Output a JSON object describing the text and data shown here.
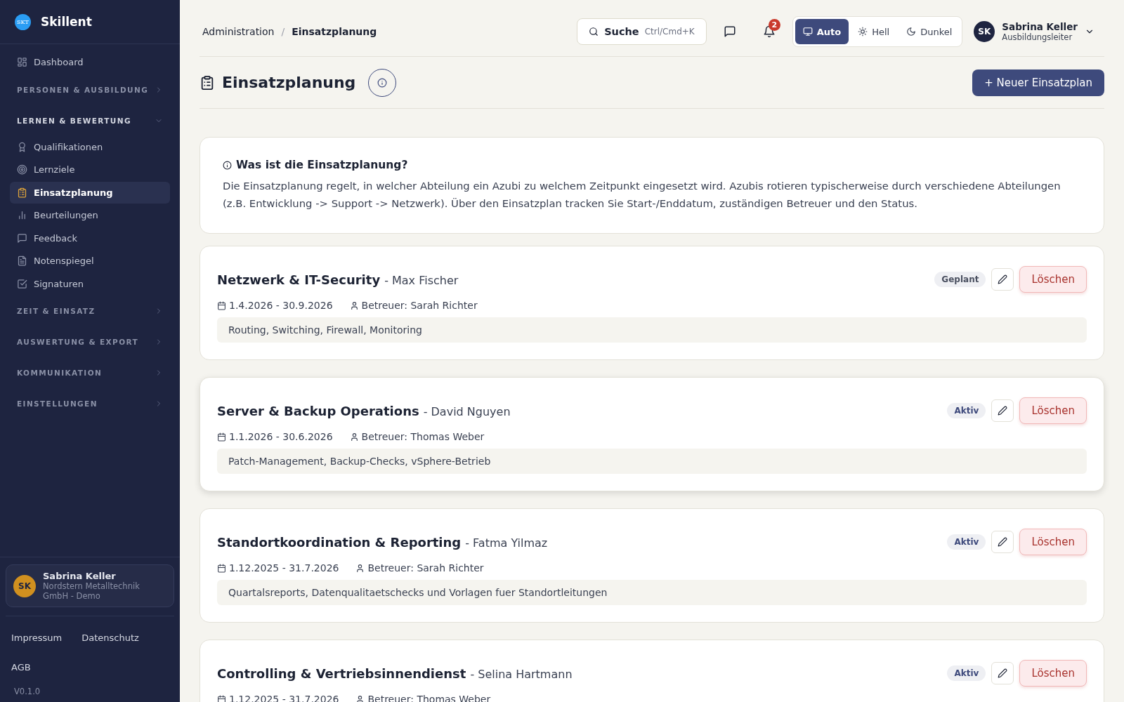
{
  "brand": {
    "logo": "SKT",
    "name": "Skillent"
  },
  "sidebar": {
    "items": [
      {
        "kind": "link",
        "label": "Dashboard",
        "selected": false
      },
      {
        "kind": "group",
        "label": "PERSONEN & AUSBILDUNG",
        "expanded": false
      },
      {
        "kind": "group",
        "label": "LERNEN & BEWERTUNG",
        "expanded": true,
        "children": [
          {
            "kind": "link",
            "label": "Qualifikationen",
            "selected": false
          },
          {
            "kind": "link",
            "label": "Lernziele",
            "selected": false
          },
          {
            "kind": "link",
            "label": "Einsatzplanung",
            "selected": true
          },
          {
            "kind": "link",
            "label": "Beurteilungen",
            "selected": false
          },
          {
            "kind": "link",
            "label": "Feedback",
            "selected": false
          },
          {
            "kind": "link",
            "label": "Notenspiegel",
            "selected": false
          },
          {
            "kind": "link",
            "label": "Signaturen",
            "selected": false
          }
        ]
      },
      {
        "kind": "group",
        "label": "ZEIT & EINSATZ",
        "expanded": false
      },
      {
        "kind": "group",
        "label": "AUSWERTUNG & EXPORT",
        "expanded": false
      },
      {
        "kind": "group",
        "label": "KOMMUNIKATION",
        "expanded": false
      },
      {
        "kind": "group",
        "label": "EINSTELLUNGEN",
        "expanded": false
      }
    ],
    "user": {
      "initials": "SK",
      "name": "Sabrina Keller",
      "org": "Nordstern Metalltechnik GmbH - Demo"
    },
    "footer_links": [
      "Impressum",
      "Datenschutz",
      "AGB"
    ],
    "version": "V0.1.0"
  },
  "header": {
    "breadcrumb": [
      "Administration",
      "/",
      "Einsatzplanung"
    ],
    "search": {
      "label": "Suche",
      "shortcut": "Ctrl/Cmd+K"
    },
    "notifications": {
      "count": "2"
    },
    "theme": [
      {
        "label": "Auto",
        "selected": true
      },
      {
        "label": "Hell",
        "selected": false
      },
      {
        "label": "Dunkel",
        "selected": false
      }
    ],
    "user": {
      "initials": "SK",
      "name": "Sabrina Keller",
      "role": "Ausbildungsleiter"
    }
  },
  "page": {
    "title": "Einsatzplanung",
    "new_button": "+ Neuer Einsatzplan"
  },
  "info": {
    "title": "Was ist die Einsatzplanung?",
    "text": "Die Einsatzplanung regelt, in welcher Abteilung ein Azubi zu welchem Zeitpunkt eingesetzt wird. Azubis rotieren typischerweise durch verschiedene Abteilungen (z.B. Entwicklung -> Support -> Netzwerk). Über den Einsatzplan tracken Sie Start-/Enddatum, zuständigen Betreuer und den Status."
  },
  "plans": [
    {
      "department": "Netzwerk & IT-Security",
      "trainee": "- Max Fischer",
      "status": "Geplant",
      "color": "#4a5060",
      "dates": "1.4.2026 - 30.9.2026",
      "supervisor": "Betreuer: Sarah Richter",
      "notes": "Routing, Switching, Firewall, Monitoring",
      "delete": "Löschen",
      "hovered": false
    },
    {
      "department": "Server & Backup Operations",
      "trainee": "- David Nguyen",
      "status": "Aktiv",
      "color": "#3e4a7c",
      "dates": "1.1.2026 - 30.6.2026",
      "supervisor": "Betreuer: Thomas Weber",
      "notes": "Patch-Management, Backup-Checks, vSphere-Betrieb",
      "delete": "Löschen",
      "hovered": true
    },
    {
      "department": "Standortkoordination & Reporting",
      "trainee": "- Fatma Yilmaz",
      "status": "Aktiv",
      "color": "#3e4a7c",
      "dates": "1.12.2025 - 31.7.2026",
      "supervisor": "Betreuer: Sarah Richter",
      "notes": "Quartalsreports, Datenqualitaetschecks und Vorlagen fuer Standortleitungen",
      "delete": "Löschen",
      "hovered": false
    },
    {
      "department": "Controlling & Vertriebsinnendienst",
      "trainee": "- Selina Hartmann",
      "status": "Aktiv",
      "color": "#3e4a7c",
      "dates": "1.12.2025 - 31.7.2026",
      "supervisor": "Betreuer: Thomas Weber",
      "delete": "Löschen",
      "hovered": false
    }
  ]
}
